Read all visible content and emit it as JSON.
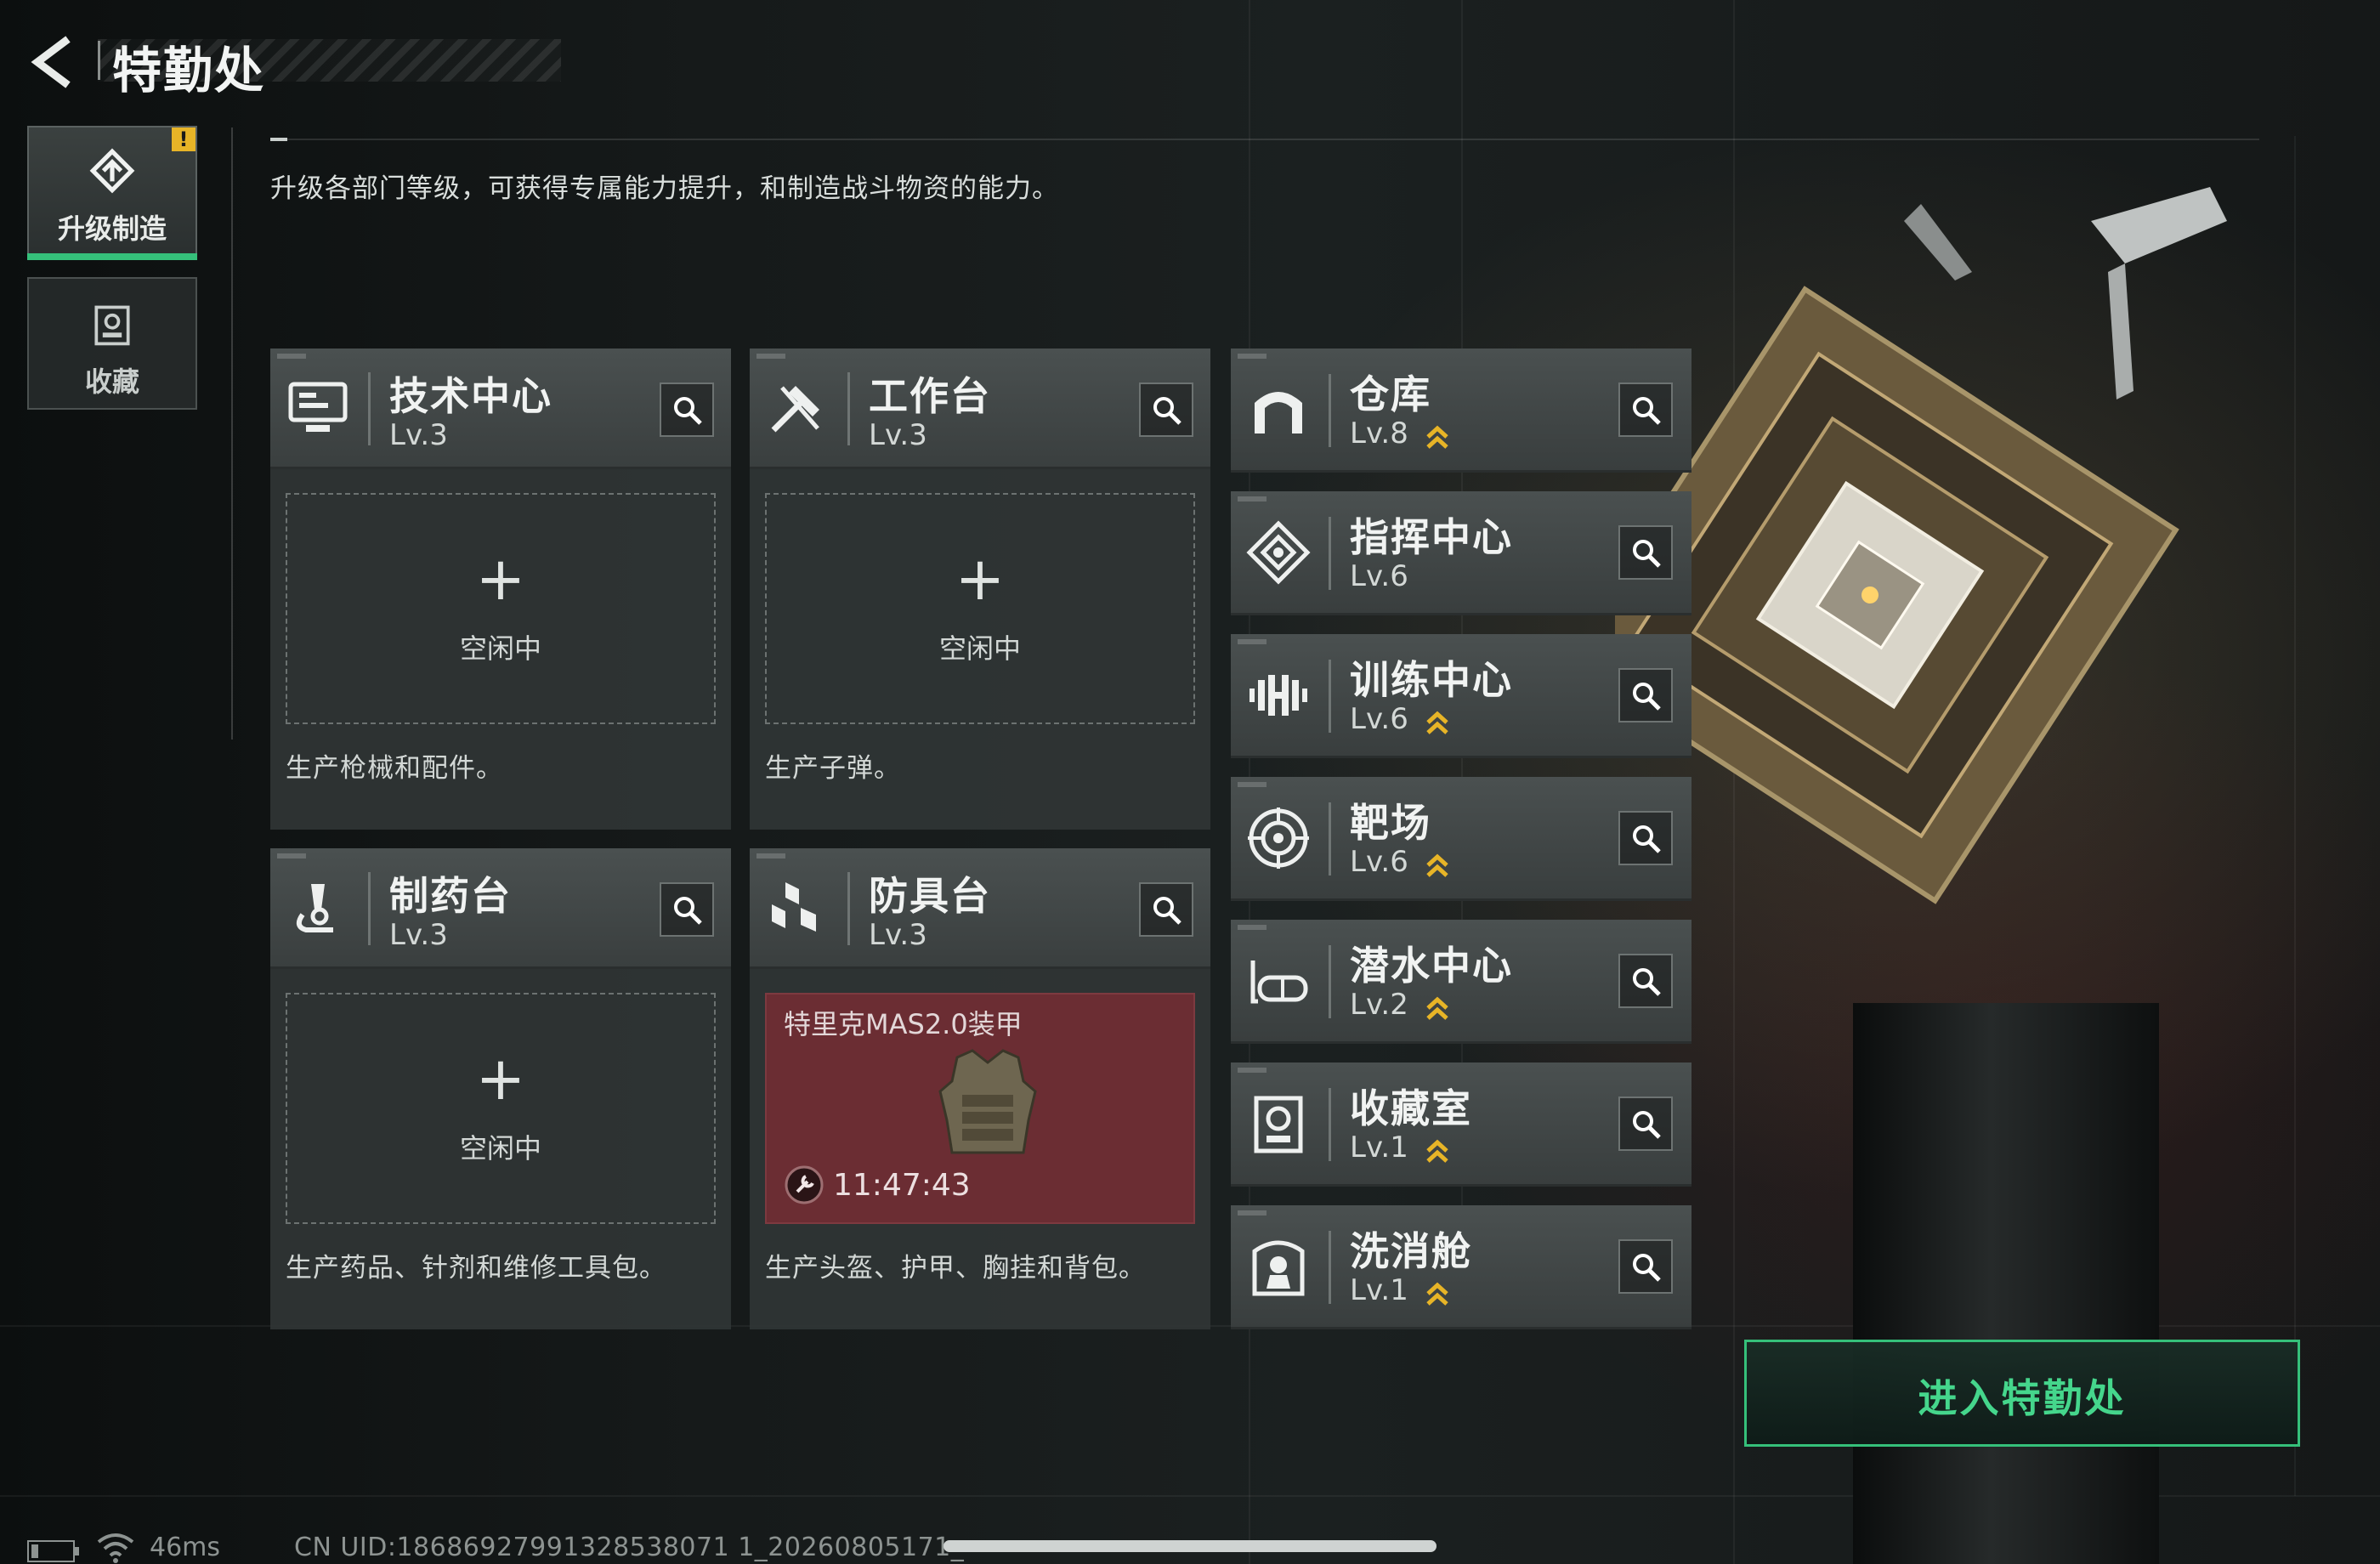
{
  "header": {
    "title": "特勤处",
    "back_icon": "back-arrow-icon"
  },
  "sidebar": {
    "items": [
      {
        "label": "升级制造",
        "icon": "upgrade-icon",
        "active": true,
        "badge": "!"
      },
      {
        "label": "收藏",
        "icon": "collection-icon",
        "active": false
      }
    ]
  },
  "description": "升级各部门等级，可获得专属能力提升，和制造战斗物资的能力。",
  "production_departments": [
    {
      "name": "技术中心",
      "level": "Lv.3",
      "icon": "computer-icon",
      "status": "空闲中",
      "desc": "生产枪械和配件。"
    },
    {
      "name": "工作台",
      "level": "Lv.3",
      "icon": "tools-icon",
      "status": "空闲中",
      "desc": "生产子弹。"
    },
    {
      "name": "制药台",
      "level": "Lv.3",
      "icon": "microscope-icon",
      "status": "空闲中",
      "desc": "生产药品、针剂和维修工具包。"
    },
    {
      "name": "防具台",
      "level": "Lv.3",
      "icon": "armor-bench-icon",
      "desc": "生产头盔、护甲、胸挂和背包。",
      "producing": {
        "item": "特里克MAS2.0装甲",
        "timer": "11:47:43",
        "item_icon": "body-armor-icon",
        "timer_icon": "wrench-timer-icon",
        "bg_color": "#6b2d33"
      }
    }
  ],
  "facilities": [
    {
      "name": "仓库",
      "level": "Lv.8",
      "icon": "warehouse-icon",
      "upgradable": true
    },
    {
      "name": "指挥中心",
      "level": "Lv.6",
      "icon": "command-icon",
      "upgradable": false
    },
    {
      "name": "训练中心",
      "level": "Lv.6",
      "icon": "dumbbell-icon",
      "upgradable": true
    },
    {
      "name": "靶场",
      "level": "Lv.6",
      "icon": "target-icon",
      "upgradable": true
    },
    {
      "name": "潜水中心",
      "level": "Lv.2",
      "icon": "diving-mask-icon",
      "upgradable": true
    },
    {
      "name": "收藏室",
      "level": "Lv.1",
      "icon": "collection-room-icon",
      "upgradable": true
    },
    {
      "name": "洗消舱",
      "level": "Lv.1",
      "icon": "decontamination-icon",
      "upgradable": true
    }
  ],
  "enter_button": "进入特勤处",
  "status_bar": {
    "ping": "46ms",
    "uid": "CN UID:18686927991328538071 1_20260805171_"
  },
  "colors": {
    "accent_green": "#35c07a",
    "upgrade_gold": "#e7b427",
    "producing_red": "#6b2d33"
  }
}
